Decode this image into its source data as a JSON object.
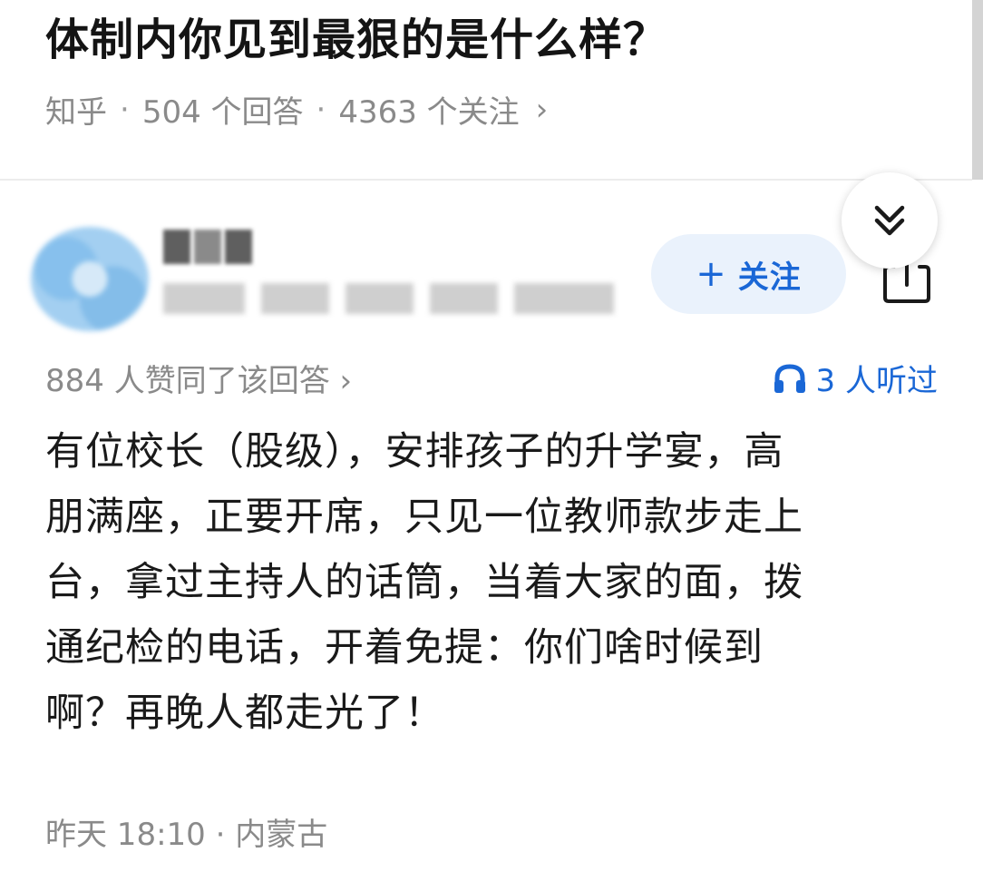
{
  "question": {
    "title": "体制内你见到最狠的是什么样？",
    "source": "知乎",
    "answers_count": "504 个回答",
    "followers_count": "4363 个关注",
    "meta_separator": "·",
    "chevron": "›"
  },
  "author": {
    "follow_label": "关注",
    "follow_plus": "+"
  },
  "answer": {
    "upvote_text": "884 人赞同了该回答 ›",
    "listen_text": "3 人听过",
    "body_lines": [
      "有位校长（股级），安排孩子的升学宴，高",
      "朋满座，正要开席，只见一位教师款步走上",
      "台，拿过主持人的话筒，当着大家的面，拨",
      "通纪检的电话，开着免提：你们啥时候到",
      "啊？再晚人都走光了！"
    ],
    "footer": "昨天 18:10 · 内蒙古"
  },
  "icons": {
    "collapse": "chevrons-down-icon",
    "share": "share-icon",
    "headphones": "headphones-icon"
  },
  "colors": {
    "accent": "#1a67d6",
    "follow_bg": "#eaf2fc",
    "meta_gray": "#8a8a8a",
    "text": "#1a1a1a"
  }
}
